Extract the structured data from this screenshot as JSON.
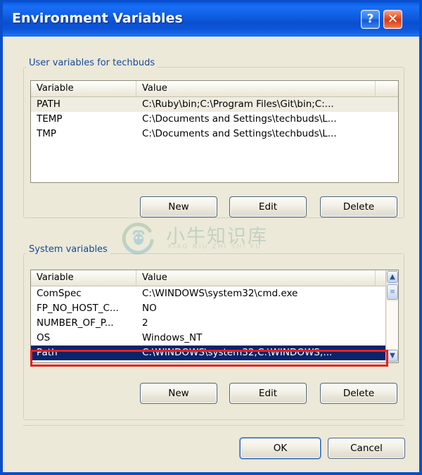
{
  "window": {
    "title": "Environment Variables",
    "help_button": "?",
    "close_button": "✕"
  },
  "user_section": {
    "label": "User variables for techbuds",
    "columns": [
      "Variable",
      "Value"
    ],
    "rows": [
      {
        "variable": "PATH",
        "value": "C:\\Ruby\\bin;C:\\Program Files\\Git\\bin;C:..."
      },
      {
        "variable": "TEMP",
        "value": "C:\\Documents and Settings\\techbuds\\L..."
      },
      {
        "variable": "TMP",
        "value": "C:\\Documents and Settings\\techbuds\\L..."
      }
    ],
    "buttons": {
      "new": "New",
      "edit": "Edit",
      "delete": "Delete"
    }
  },
  "system_section": {
    "label": "System variables",
    "columns": [
      "Variable",
      "Value"
    ],
    "rows": [
      {
        "variable": "ComSpec",
        "value": "C:\\WINDOWS\\system32\\cmd.exe"
      },
      {
        "variable": "FP_NO_HOST_C...",
        "value": "NO"
      },
      {
        "variable": "NUMBER_OF_P...",
        "value": "2"
      },
      {
        "variable": "OS",
        "value": "Windows_NT"
      },
      {
        "variable": "Path",
        "value": "C:\\WINDOWS\\system32;C:\\WINDOWS;..."
      }
    ],
    "selected_row_index": 4,
    "buttons": {
      "new": "New",
      "edit": "Edit",
      "delete": "Delete"
    },
    "scrollbar": {
      "up_arrow": "▲",
      "down_arrow": "▼",
      "thumb": "≡"
    }
  },
  "dialog_buttons": {
    "ok": "OK",
    "cancel": "Cancel"
  },
  "watermark": {
    "chinese": "小牛知识库",
    "pinyin": "XIAO NIU ZHI SHI KU"
  },
  "colors": {
    "titlebar_blue": "#0f5fe2",
    "dialog_bg": "#ece9d8",
    "group_label_blue": "#16499c",
    "selection_blue": "#0a246a",
    "annotation_red": "#e8211c",
    "watermark_teal": "#6f9c8e"
  }
}
